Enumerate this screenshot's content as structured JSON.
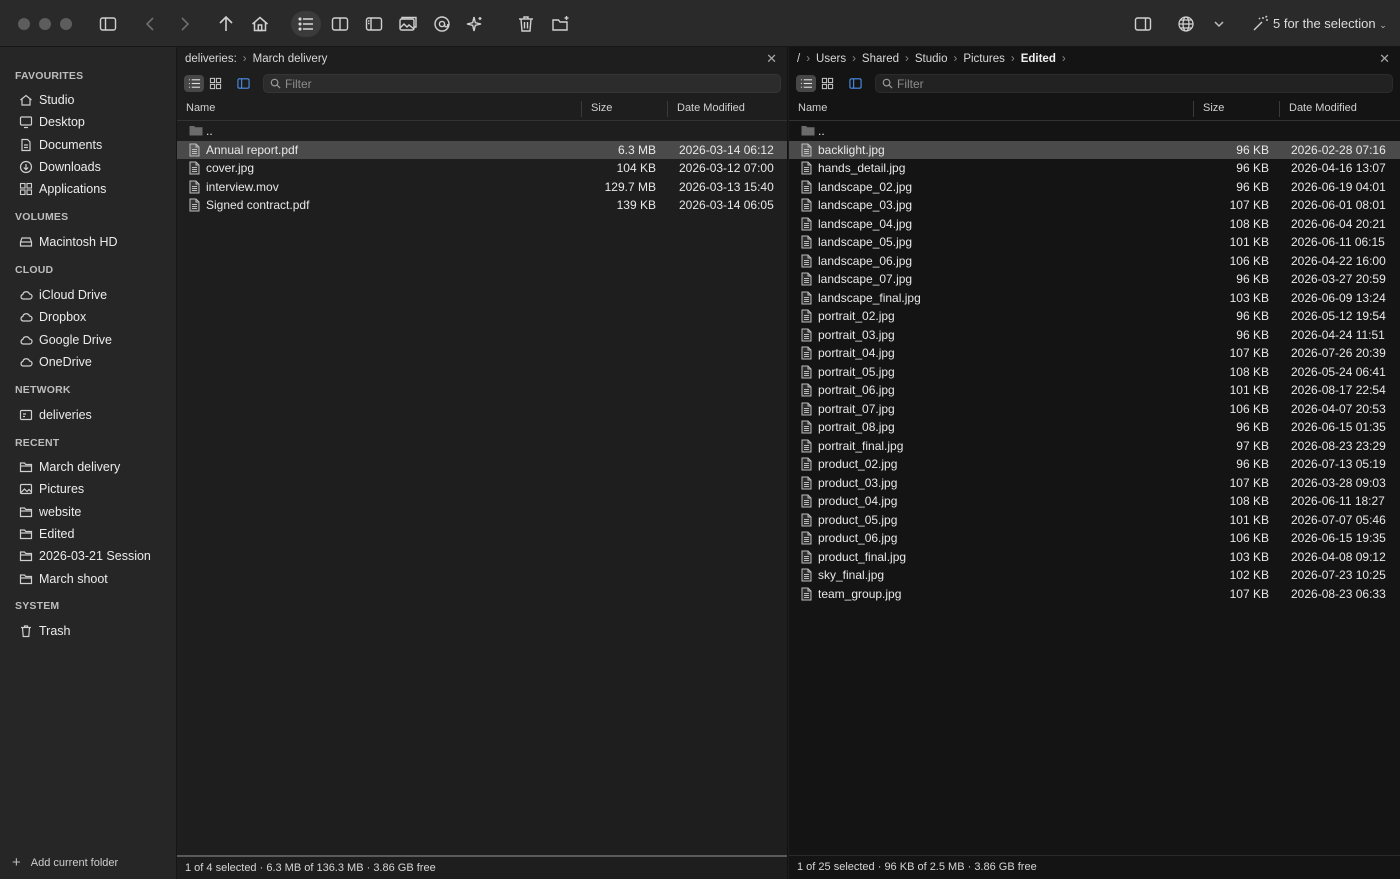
{
  "toolbar": {
    "selection_label": "5 for the selection",
    "icons": [
      "sidebar-toggle-icon",
      "back-icon",
      "forward-icon",
      "up-arrow-icon",
      "home-icon",
      "list-view-icon",
      "split-view-icon",
      "preview-pane-icon",
      "image-viewer-icon",
      "at-sign-icon",
      "sparkle-icon",
      "trash-icon",
      "new-folder-icon",
      "right-panel-icon",
      "globe-icon",
      "chevron-down-icon",
      "magic-wand-icon"
    ]
  },
  "sidebar": {
    "favourites_title": "FAVOURITES",
    "favourites": [
      {
        "label": "Studio",
        "icon": "home-icon"
      },
      {
        "label": "Desktop",
        "icon": "desktop-icon"
      },
      {
        "label": "Documents",
        "icon": "document-icon"
      },
      {
        "label": "Downloads",
        "icon": "download-icon"
      },
      {
        "label": "Applications",
        "icon": "applications-icon"
      }
    ],
    "volumes_title": "VOLUMES",
    "volumes": [
      {
        "label": "Macintosh HD",
        "icon": "disk-icon"
      }
    ],
    "cloud_title": "CLOUD",
    "cloud": [
      {
        "label": "iCloud Drive",
        "icon": "cloud-icon"
      },
      {
        "label": "Dropbox",
        "icon": "cloud-icon"
      },
      {
        "label": "Google Drive",
        "icon": "cloud-icon"
      },
      {
        "label": "OneDrive",
        "icon": "cloud-icon"
      }
    ],
    "network_title": "NETWORK",
    "network": [
      {
        "label": "deliveries",
        "icon": "server-icon"
      }
    ],
    "recent_title": "RECENT",
    "recent": [
      {
        "label": "March delivery",
        "icon": "folder-icon"
      },
      {
        "label": "Pictures",
        "icon": "pictures-icon"
      },
      {
        "label": "website",
        "icon": "folder-icon"
      },
      {
        "label": "Edited",
        "icon": "folder-icon"
      },
      {
        "label": "2026-03-21 Session",
        "icon": "folder-icon"
      },
      {
        "label": "March shoot",
        "icon": "folder-icon"
      }
    ],
    "system_title": "SYSTEM",
    "system": [
      {
        "label": "Trash",
        "icon": "trash-icon"
      }
    ],
    "footer_label": "Add current folder"
  },
  "left_pane": {
    "path_root": "deliveries:",
    "path_current": "March delivery",
    "filter_placeholder": "Filter",
    "columns": {
      "name": "Name",
      "size": "Size",
      "date": "Date Modified"
    },
    "parent": "..",
    "files": [
      {
        "name": "Annual report.pdf",
        "size": "6.3 MB",
        "date": "2026-03-14 06:12",
        "selected": true
      },
      {
        "name": "cover.jpg",
        "size": "104 KB",
        "date": "2026-03-12 07:00",
        "selected": false
      },
      {
        "name": "interview.mov",
        "size": "129.7 MB",
        "date": "2026-03-13 15:40",
        "selected": false
      },
      {
        "name": "Signed contract.pdf",
        "size": "139 KB",
        "date": "2026-03-14 06:05",
        "selected": false
      }
    ],
    "status": "1 of 4 selected · 6.3 MB of 136.3 MB · 3.86 GB free"
  },
  "right_pane": {
    "path": [
      "/",
      "Users",
      "Shared",
      "Studio",
      "Pictures",
      "Edited"
    ],
    "filter_placeholder": "Filter",
    "columns": {
      "name": "Name",
      "size": "Size",
      "date": "Date Modified"
    },
    "parent": "..",
    "files": [
      {
        "name": "backlight.jpg",
        "size": "96 KB",
        "date": "2026-02-28 07:16",
        "selected": true
      },
      {
        "name": "hands_detail.jpg",
        "size": "96 KB",
        "date": "2026-04-16 13:07"
      },
      {
        "name": "landscape_02.jpg",
        "size": "96 KB",
        "date": "2026-06-19 04:01"
      },
      {
        "name": "landscape_03.jpg",
        "size": "107 KB",
        "date": "2026-06-01 08:01"
      },
      {
        "name": "landscape_04.jpg",
        "size": "108 KB",
        "date": "2026-06-04 20:21"
      },
      {
        "name": "landscape_05.jpg",
        "size": "101 KB",
        "date": "2026-06-11 06:15"
      },
      {
        "name": "landscape_06.jpg",
        "size": "106 KB",
        "date": "2026-04-22 16:00"
      },
      {
        "name": "landscape_07.jpg",
        "size": "96 KB",
        "date": "2026-03-27 20:59"
      },
      {
        "name": "landscape_final.jpg",
        "size": "103 KB",
        "date": "2026-06-09 13:24"
      },
      {
        "name": "portrait_02.jpg",
        "size": "96 KB",
        "date": "2026-05-12 19:54"
      },
      {
        "name": "portrait_03.jpg",
        "size": "96 KB",
        "date": "2026-04-24 11:51"
      },
      {
        "name": "portrait_04.jpg",
        "size": "107 KB",
        "date": "2026-07-26 20:39"
      },
      {
        "name": "portrait_05.jpg",
        "size": "108 KB",
        "date": "2026-05-24 06:41"
      },
      {
        "name": "portrait_06.jpg",
        "size": "101 KB",
        "date": "2026-08-17 22:54"
      },
      {
        "name": "portrait_07.jpg",
        "size": "106 KB",
        "date": "2026-04-07 20:53"
      },
      {
        "name": "portrait_08.jpg",
        "size": "96 KB",
        "date": "2026-06-15 01:35"
      },
      {
        "name": "portrait_final.jpg",
        "size": "97 KB",
        "date": "2026-08-23 23:29"
      },
      {
        "name": "product_02.jpg",
        "size": "96 KB",
        "date": "2026-07-13 05:19"
      },
      {
        "name": "product_03.jpg",
        "size": "107 KB",
        "date": "2026-03-28 09:03"
      },
      {
        "name": "product_04.jpg",
        "size": "108 KB",
        "date": "2026-06-11 18:27"
      },
      {
        "name": "product_05.jpg",
        "size": "101 KB",
        "date": "2026-07-07 05:46"
      },
      {
        "name": "product_06.jpg",
        "size": "106 KB",
        "date": "2026-06-15 19:35"
      },
      {
        "name": "product_final.jpg",
        "size": "103 KB",
        "date": "2026-04-08 09:12"
      },
      {
        "name": "sky_final.jpg",
        "size": "102 KB",
        "date": "2026-07-23 10:25"
      },
      {
        "name": "team_group.jpg",
        "size": "107 KB",
        "date": "2026-08-23 06:33"
      }
    ],
    "status": "1 of 25 selected · 96 KB of 2.5 MB · 3.86 GB free"
  }
}
